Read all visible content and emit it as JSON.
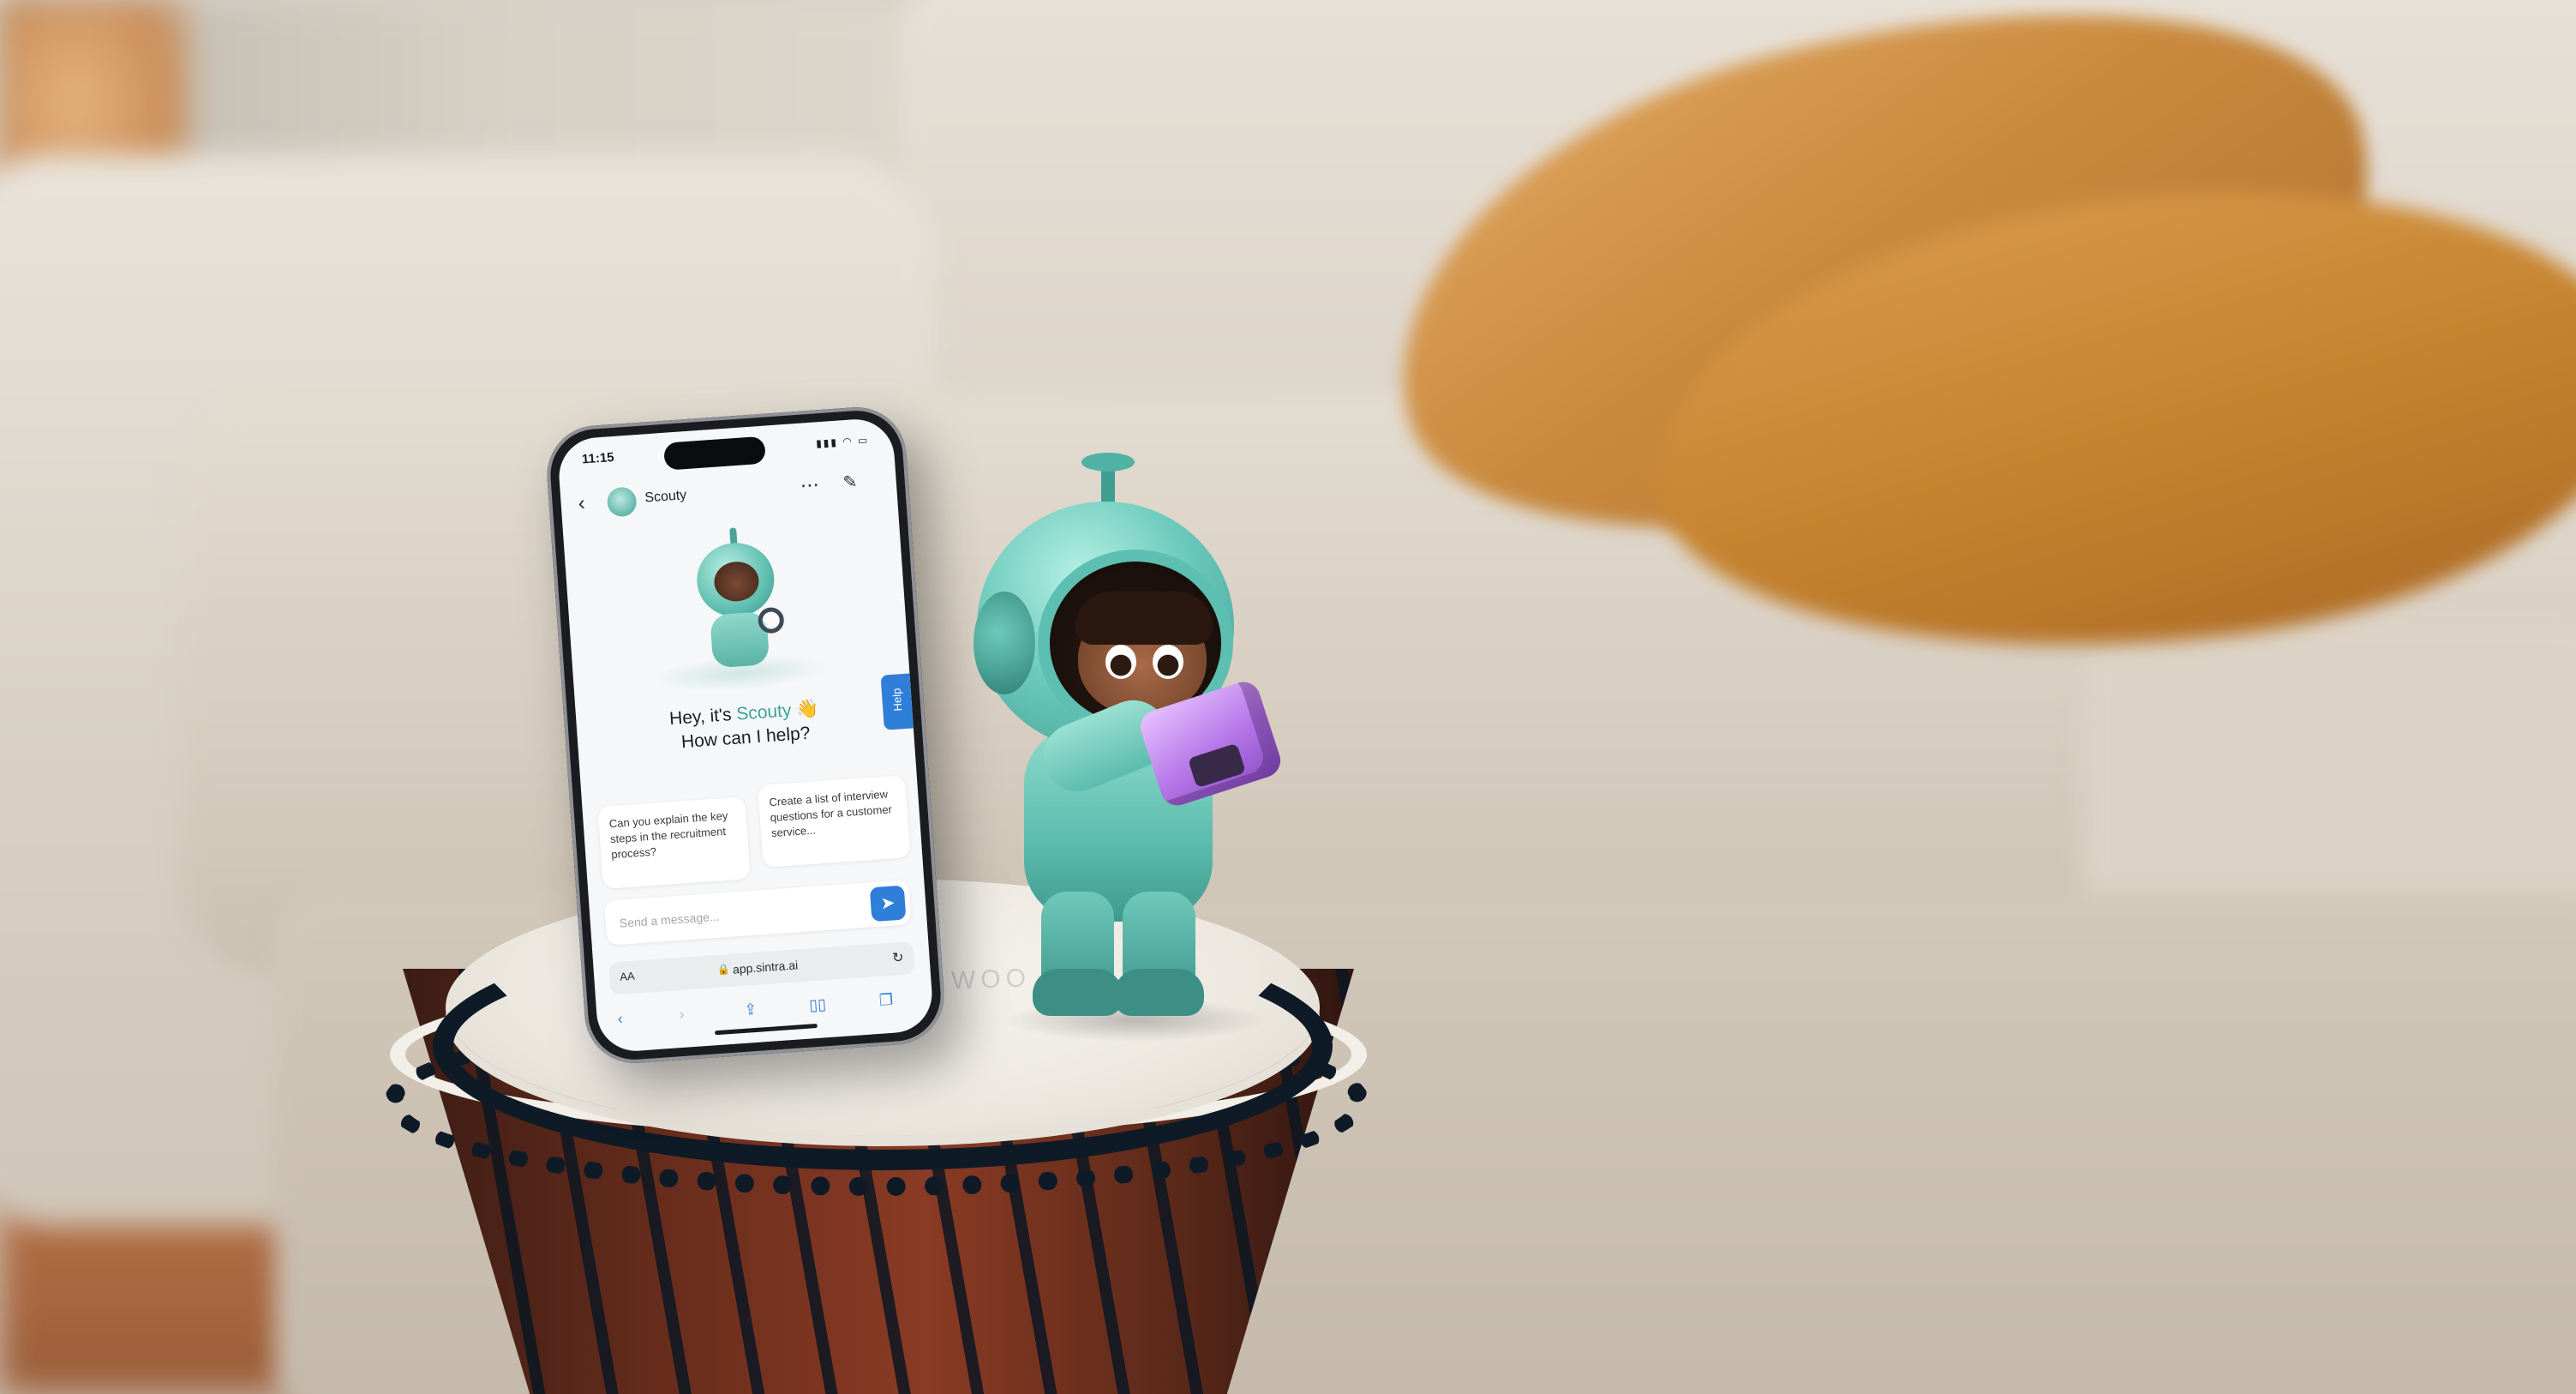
{
  "phone": {
    "status_time": "11:15",
    "agent_name": "Scouty",
    "greeting_prefix": "Hey, it's ",
    "greeting_name": "Scouty",
    "greeting_emoji": "👋",
    "greeting_line2": "How can I help?",
    "help_label": "Help",
    "suggestions": [
      "Can you explain the key steps in the recruitment process?",
      "Create a list of interview questions for a customer service..."
    ],
    "message_placeholder": "Send a message...",
    "url_aa": "AA",
    "url_text": "app.sintra.ai"
  },
  "drum_logo": "WOO",
  "icons": {
    "back": "back-chevron-icon",
    "more": "more-dots-icon",
    "edit": "edit-icon",
    "send": "send-icon",
    "lock": "lock-icon",
    "reload": "reload-icon"
  },
  "colors": {
    "accent": "#3aa395",
    "primary_blue": "#2f7fd9",
    "pillow": "#c98a3e",
    "figurine_teal": "#5bbcad",
    "camera_purple": "#b576e8"
  }
}
